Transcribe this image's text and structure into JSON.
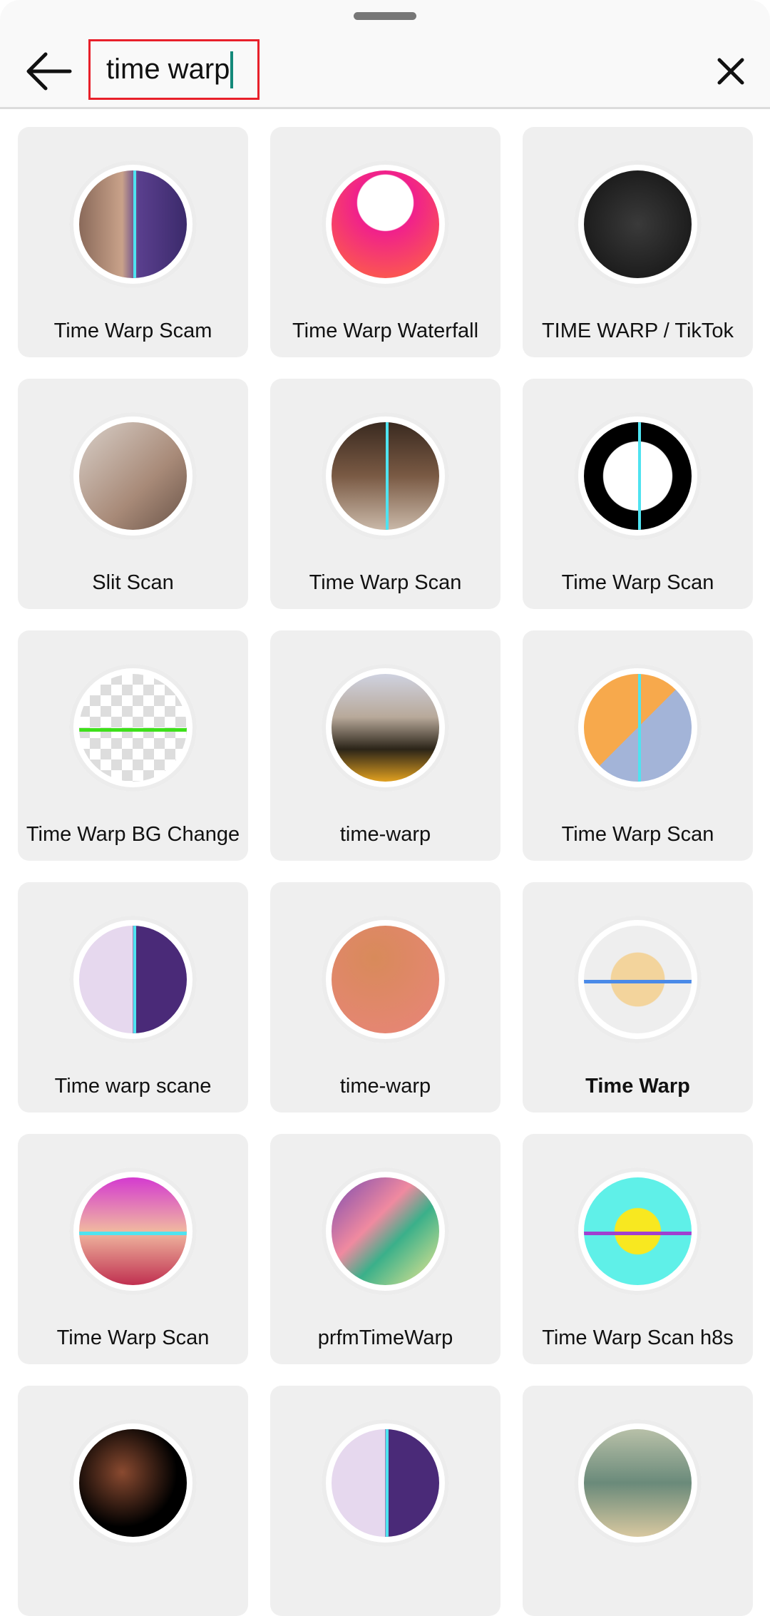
{
  "search": {
    "value": "time warp"
  },
  "icons": {
    "back": "arrow-left-icon",
    "close": "close-icon"
  },
  "colors": {
    "highlight_border": "#e8202a",
    "caret": "#14897a"
  },
  "results": [
    {
      "label": "Time Warp Scam",
      "thumb": "slit-face-purple",
      "bg": "linear-gradient(90deg,#8a6a5a,#c9a28a 40%,#5a3f8e 55%,#3b2a6b)",
      "line": "v"
    },
    {
      "label": "Time Warp Waterfall",
      "thumb": "jellyfish-pink",
      "bg": "radial-gradient(circle at 50% 30%,#fff 0 30%,#f0208c 31%,#ff6a3c)",
      "line": ""
    },
    {
      "label": "TIME WARP / TikTok",
      "thumb": "tiktok-clock",
      "bg": "radial-gradient(circle,#3a3a3a,#111)",
      "line": ""
    },
    {
      "label": "Slit Scan",
      "thumb": "stretched-face",
      "bg": "linear-gradient(135deg,#d8cfc8,#a88a78 60%,#6a5448)",
      "line": ""
    },
    {
      "label": "Time Warp Scan",
      "thumb": "man-photo",
      "bg": "linear-gradient(180deg,#3a2a20,#7a5a44 50%,#c9b8a8)",
      "line": "v"
    },
    {
      "label": "Time Warp Scan",
      "thumb": "black-white-face",
      "bg": "radial-gradient(circle,#fff 0 45%,#000 46%)",
      "line": "v"
    },
    {
      "label": "Time Warp BG Change",
      "thumb": "sketch-woman",
      "bg": "repeating-conic-gradient(#ddd 0 25%,#fff 0 50%) 0 0/30px 30px",
      "line": "h-green"
    },
    {
      "label": "time-warp",
      "thumb": "girl-floral",
      "bg": "linear-gradient(180deg,#cfd2e0,#b8a99a 40%,#2b2418 70%,#e0a020)",
      "line": ""
    },
    {
      "label": "Time Warp Scan",
      "thumb": "cartoon-face",
      "bg": "linear-gradient(135deg,#f7a94c 50%,#a3b4d8 50%)",
      "line": "v"
    },
    {
      "label": "Time warp scane",
      "thumb": "purple-face",
      "bg": "linear-gradient(90deg,#e6d8ee 50%,#4a2a78 50%)",
      "line": "v"
    },
    {
      "label": "time-warp",
      "thumb": "melting-clock",
      "bg": "radial-gradient(circle at 40% 30%,#d88a5a,#e9857a)",
      "line": ""
    },
    {
      "label": "Time Warp",
      "thumb": "tan-head",
      "bg": "radial-gradient(circle,#f3d49c 0 35%,#eee 36%)",
      "line": "h-blue",
      "bold": true
    },
    {
      "label": "Time Warp Scan",
      "thumb": "woman-tongue",
      "bg": "linear-gradient(180deg,#d43ad0,#f0b8a0 50%,#c03050)",
      "line": "h-cyan"
    },
    {
      "label": "prfmTimeWarp",
      "thumb": "pastel-stairs",
      "bg": "linear-gradient(135deg,#7a4ab0,#f08aa0 40%,#3ab08a 60%,#f0e890)",
      "line": ""
    },
    {
      "label": "Time Warp Scan h8s",
      "thumb": "yellow-smiley",
      "bg": "radial-gradient(circle,#f8e820 0 30%,#5ff0e8 31%)",
      "line": "h-purple"
    },
    {
      "label": "",
      "thumb": "dark-swirl",
      "bg": "radial-gradient(circle at 40% 40%,#8a4a30,#000 60%)",
      "line": ""
    },
    {
      "label": "",
      "thumb": "purple-face-dark",
      "bg": "linear-gradient(90deg,#e6d8ee 50%,#4a2a78 50%)",
      "line": "v"
    },
    {
      "label": "",
      "thumb": "street-scene",
      "bg": "linear-gradient(180deg,#b8c0a8,#6a8a7a 50%,#d8c8a0)",
      "line": ""
    }
  ]
}
